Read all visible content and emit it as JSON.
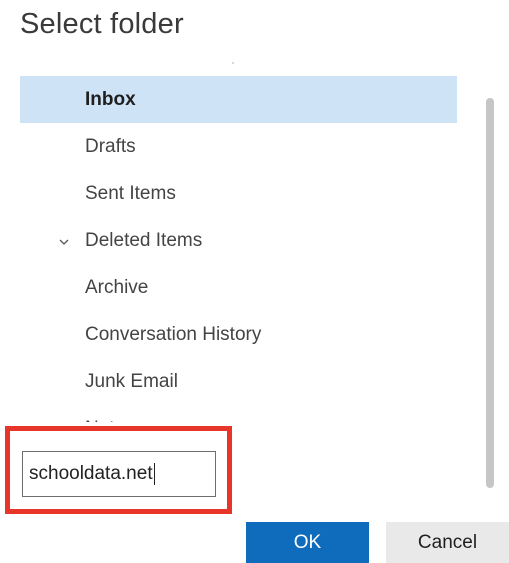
{
  "dialog": {
    "title": "Select folder"
  },
  "folders": [
    {
      "label": "Inbox",
      "selected": true
    },
    {
      "label": "Drafts"
    },
    {
      "label": "Sent Items"
    },
    {
      "label": "Deleted Items",
      "chevron": "⌄"
    },
    {
      "label": "Archive"
    },
    {
      "label": "Conversation History"
    },
    {
      "label": "Junk Email"
    },
    {
      "label": "Notes"
    }
  ],
  "new_folder_input": {
    "value": "schooldata.net"
  },
  "buttons": {
    "ok_label": "OK",
    "cancel_label": "Cancel"
  },
  "colors": {
    "selected_row": "#cfe3f6",
    "primary_button": "#0f6cbd",
    "highlight_border": "#e8352a",
    "secondary_button": "#e9e9e9"
  },
  "icons": {
    "expand": "chevron-down-icon"
  }
}
